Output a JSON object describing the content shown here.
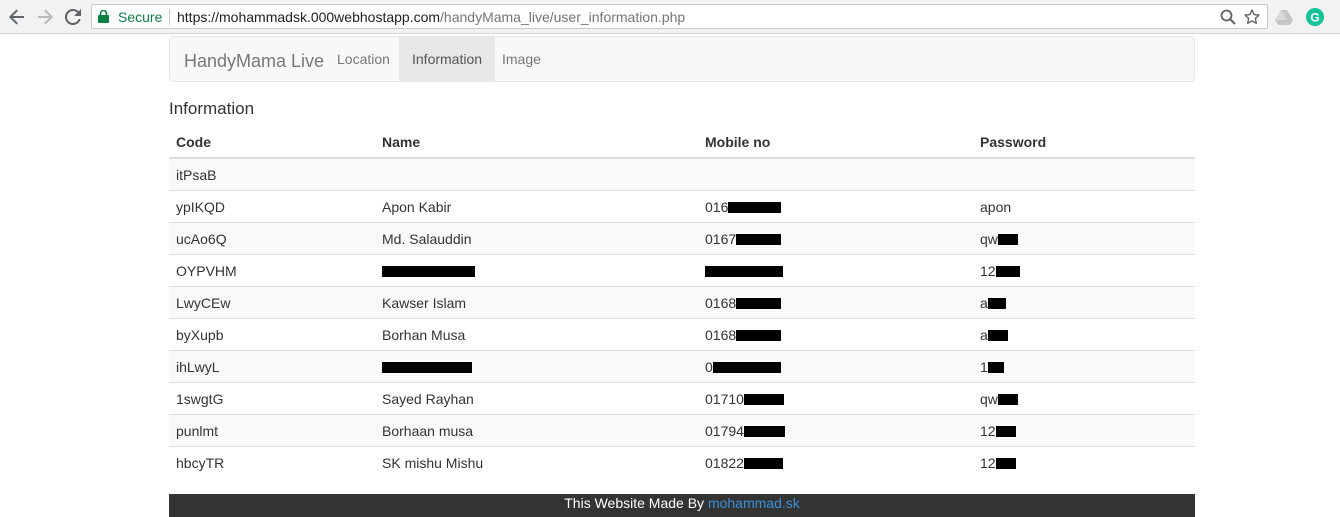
{
  "browser": {
    "secure_label": "Secure",
    "url_host": "https://mohammadsk.000webhostapp.com",
    "url_path": "/handyMama_live/user_information.php"
  },
  "navbar": {
    "brand": "HandyMama Live",
    "links": [
      "Location",
      "Information",
      "Image"
    ],
    "active": "Information"
  },
  "section_title": "Information",
  "table": {
    "headers": [
      "Code",
      "Name",
      "Mobile no",
      "Password"
    ],
    "rows": [
      {
        "code": "itPsaB",
        "name": "",
        "mobile": "",
        "password": ""
      },
      {
        "code": "ypIKQD",
        "name": "Apon Kabir",
        "mobile": "016",
        "password": "apon"
      },
      {
        "code": "ucAo6Q",
        "name": "Md. Salauddin",
        "mobile": "0167",
        "password": "qw"
      },
      {
        "code": "OYPVHM",
        "name": "",
        "mobile": "",
        "password": "12"
      },
      {
        "code": "LwyCEw",
        "name": "Kawser Islam",
        "mobile": "0168",
        "password": "a"
      },
      {
        "code": "byXupb",
        "name": "Borhan Musa",
        "mobile": "0168",
        "password": "a"
      },
      {
        "code": "ihLwyL",
        "name": "",
        "mobile": "0",
        "password": "1"
      },
      {
        "code": "1swgtG",
        "name": "Sayed Rayhan",
        "mobile": "01710",
        "password": "qw"
      },
      {
        "code": "punlmt",
        "name": "Borhaan musa",
        "mobile": "01794",
        "password": "12"
      },
      {
        "code": "hbcyTR",
        "name": "SK mishu Mishu",
        "mobile": "01822",
        "password": "12"
      }
    ]
  },
  "footer": {
    "text": "This Website Made By ",
    "author": "mohammad.sk"
  },
  "colors": {
    "footer_bg": "#333333",
    "author_link": "#3b8fd6",
    "secure_green": "#0b8043"
  },
  "icons": [
    "back-arrow-icon",
    "forward-arrow-icon",
    "reload-icon",
    "lock-icon",
    "zoom-icon",
    "star-icon",
    "drive-icon",
    "grammarly-icon"
  ]
}
